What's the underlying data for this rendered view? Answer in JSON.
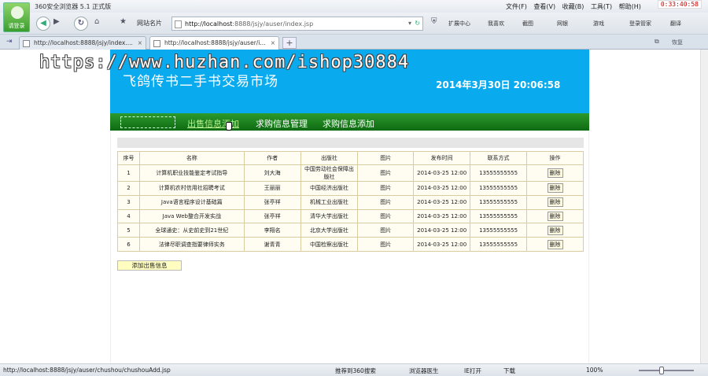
{
  "browser": {
    "avatar_label": "请登录",
    "app_title": "360安全浏览器 5.1 正式版",
    "menus": [
      "文件(F)",
      "查看(V)",
      "收藏(B)",
      "工具(T)",
      "帮助(H)"
    ],
    "clock": "0:33:40:58",
    "sites_label": "网站名片",
    "url_host": "http://localhost",
    "url_rest": ":8888/jsjy/auser/index.jsp",
    "toolbar_items": [
      "扩展中心",
      "我喜欢",
      "截图",
      "网银",
      "游戏",
      "登录管家",
      "翻译"
    ],
    "tabs": [
      {
        "title": "http://localhost:8888/jsjy/index....",
        "active": false
      },
      {
        "title": "http://localhost:8888/jsjy/auser/i...",
        "active": true
      }
    ],
    "new_tab": "+",
    "restore_label": "恢复",
    "status_url": "http://localhost:8888/jsjy/auser/chushou/chushouAdd.jsp",
    "status_items": [
      "推荐到360搜索",
      "浏览器医生",
      "IE打开",
      "下载"
    ],
    "zoom": "100%"
  },
  "watermark": "https://www.huzhan.com/ishop30884",
  "page": {
    "site_title": "飞鸽传书二手书交易市场",
    "datetime": "2014年3月30日  20:06:58",
    "nav": [
      "出售信息添加",
      "求购信息管理",
      "求购信息添加"
    ],
    "table": {
      "headers": [
        "序号",
        "名称",
        "作者",
        "出版社",
        "图片",
        "发布时间",
        "联系方式",
        "操作"
      ],
      "rows": [
        [
          "1",
          "计算机职业技能鉴定考试指导",
          "刘大海",
          "中国劳动社会保障出版社",
          "图片",
          "2014-03-25 12:00",
          "13555555555",
          "删除"
        ],
        [
          "2",
          "计算机农村信用社招聘考试",
          "王丽丽",
          "中国经济出版社",
          "图片",
          "2014-03-25 12:00",
          "13555555555",
          "删除"
        ],
        [
          "3",
          "Java语言程序设计基础篇",
          "张亭祥",
          "机械工业出版社",
          "图片",
          "2014-03-25 12:00",
          "13555555555",
          "删除"
        ],
        [
          "4",
          "Java Web整合开发实战",
          "张亭祥",
          "清华大学出版社",
          "图片",
          "2014-03-25 12:00",
          "13555555555",
          "删除"
        ],
        [
          "5",
          "全球通史：从史前史到21世纪",
          "李翔名",
          "北京大学出版社",
          "图片",
          "2014-03-25 12:00",
          "13555555555",
          "删除"
        ],
        [
          "6",
          "法律尽职调查指要律师实务",
          "谢青青",
          "中国检察出版社",
          "图片",
          "2014-03-25 12:00",
          "13555555555",
          "删除"
        ]
      ]
    },
    "add_button": "添加出售信息"
  },
  "colors": {
    "banner": "#0aaaee",
    "nav": "#0e6a12",
    "nav_active": "#b9f08e"
  }
}
